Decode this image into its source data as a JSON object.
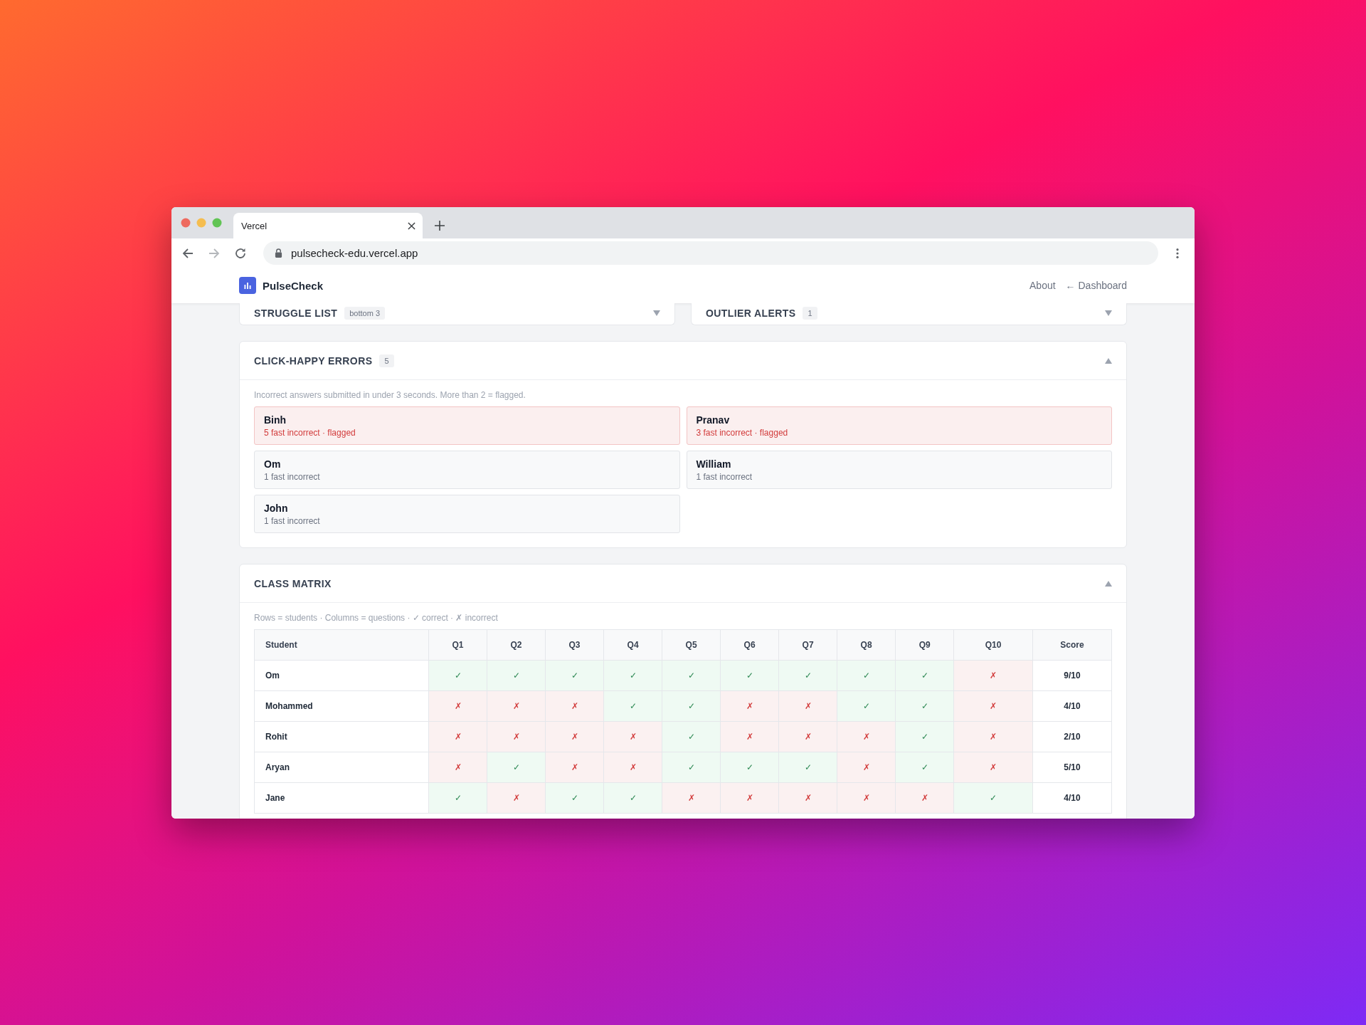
{
  "browser": {
    "tab_title": "Vercel",
    "url": "pulsecheck-edu.vercel.app"
  },
  "app": {
    "logo_text": "PulseCheck",
    "nav": [
      {
        "label": "About"
      },
      {
        "label": "← Dashboard"
      }
    ]
  },
  "top_panels": [
    {
      "title": "STRUGGLE LIST",
      "badge": "bottom 3",
      "expanded": false
    },
    {
      "title": "OUTLIER ALERTS",
      "badge": "1",
      "expanded": false
    }
  ],
  "click_happy": {
    "title": "CLICK-HAPPY ERRORS",
    "badge": "5",
    "expanded": true,
    "description": "Incorrect answers submitted in under 3 seconds. More than 2 = flagged.",
    "students": [
      {
        "name": "Binh",
        "detail": "5 fast incorrect · flagged",
        "flagged": true
      },
      {
        "name": "Pranav",
        "detail": "3 fast incorrect · flagged",
        "flagged": true
      },
      {
        "name": "Om",
        "detail": "1 fast incorrect",
        "flagged": false
      },
      {
        "name": "William",
        "detail": "1 fast incorrect",
        "flagged": false
      },
      {
        "name": "John",
        "detail": "1 fast incorrect",
        "flagged": false
      }
    ]
  },
  "class_matrix": {
    "title": "CLASS MATRIX",
    "expanded": true,
    "legend": "Rows = students · Columns = questions · ✓ correct · ✗ incorrect",
    "columns": [
      "Student",
      "Q1",
      "Q2",
      "Q3",
      "Q4",
      "Q5",
      "Q6",
      "Q7",
      "Q8",
      "Q9",
      "Q10",
      "Score"
    ],
    "rows": [
      {
        "cells": [
          {
            "kind": "student",
            "text": "Om"
          },
          {
            "kind": "answer",
            "text": "✓",
            "correct": true
          },
          {
            "kind": "answer",
            "text": "✓",
            "correct": true
          },
          {
            "kind": "answer",
            "text": "✓",
            "correct": true
          },
          {
            "kind": "answer",
            "text": "✓",
            "correct": true
          },
          {
            "kind": "answer",
            "text": "✓",
            "correct": true
          },
          {
            "kind": "answer",
            "text": "✓",
            "correct": true
          },
          {
            "kind": "answer",
            "text": "✓",
            "correct": true
          },
          {
            "kind": "answer",
            "text": "✓",
            "correct": true
          },
          {
            "kind": "answer",
            "text": "✓",
            "correct": true
          },
          {
            "kind": "answer",
            "text": "✗",
            "correct": false
          },
          {
            "kind": "score",
            "text": "9/10"
          }
        ]
      },
      {
        "cells": [
          {
            "kind": "student",
            "text": "Mohammed"
          },
          {
            "kind": "answer",
            "text": "✗",
            "correct": false
          },
          {
            "kind": "answer",
            "text": "✗",
            "correct": false
          },
          {
            "kind": "answer",
            "text": "✗",
            "correct": false
          },
          {
            "kind": "answer",
            "text": "✓",
            "correct": true
          },
          {
            "kind": "answer",
            "text": "✓",
            "correct": true
          },
          {
            "kind": "answer",
            "text": "✗",
            "correct": false
          },
          {
            "kind": "answer",
            "text": "✗",
            "correct": false
          },
          {
            "kind": "answer",
            "text": "✓",
            "correct": true
          },
          {
            "kind": "answer",
            "text": "✓",
            "correct": true
          },
          {
            "kind": "answer",
            "text": "✗",
            "correct": false
          },
          {
            "kind": "score",
            "text": "4/10"
          }
        ]
      },
      {
        "cells": [
          {
            "kind": "student",
            "text": "Rohit"
          },
          {
            "kind": "answer",
            "text": "✗",
            "correct": false
          },
          {
            "kind": "answer",
            "text": "✗",
            "correct": false
          },
          {
            "kind": "answer",
            "text": "✗",
            "correct": false
          },
          {
            "kind": "answer",
            "text": "✗",
            "correct": false
          },
          {
            "kind": "answer",
            "text": "✓",
            "correct": true
          },
          {
            "kind": "answer",
            "text": "✗",
            "correct": false
          },
          {
            "kind": "answer",
            "text": "✗",
            "correct": false
          },
          {
            "kind": "answer",
            "text": "✗",
            "correct": false
          },
          {
            "kind": "answer",
            "text": "✓",
            "correct": true
          },
          {
            "kind": "answer",
            "text": "✗",
            "correct": false
          },
          {
            "kind": "score",
            "text": "2/10"
          }
        ]
      },
      {
        "cells": [
          {
            "kind": "student",
            "text": "Aryan"
          },
          {
            "kind": "answer",
            "text": "✗",
            "correct": false
          },
          {
            "kind": "answer",
            "text": "✓",
            "correct": true
          },
          {
            "kind": "answer",
            "text": "✗",
            "correct": false
          },
          {
            "kind": "answer",
            "text": "✗",
            "correct": false
          },
          {
            "kind": "answer",
            "text": "✓",
            "correct": true
          },
          {
            "kind": "answer",
            "text": "✓",
            "correct": true
          },
          {
            "kind": "answer",
            "text": "✓",
            "correct": true
          },
          {
            "kind": "answer",
            "text": "✗",
            "correct": false
          },
          {
            "kind": "answer",
            "text": "✓",
            "correct": true
          },
          {
            "kind": "answer",
            "text": "✗",
            "correct": false
          },
          {
            "kind": "score",
            "text": "5/10"
          }
        ]
      },
      {
        "cells": [
          {
            "kind": "student",
            "text": "Jane"
          },
          {
            "kind": "answer",
            "text": "✓",
            "correct": true
          },
          {
            "kind": "answer",
            "text": "✗",
            "correct": false
          },
          {
            "kind": "answer",
            "text": "✓",
            "correct": true
          },
          {
            "kind": "answer",
            "text": "✓",
            "correct": true
          },
          {
            "kind": "answer",
            "text": "✗",
            "correct": false
          },
          {
            "kind": "answer",
            "text": "✗",
            "correct": false
          },
          {
            "kind": "answer",
            "text": "✗",
            "correct": false
          },
          {
            "kind": "answer",
            "text": "✗",
            "correct": false
          },
          {
            "kind": "answer",
            "text": "✗",
            "correct": false
          },
          {
            "kind": "answer",
            "text": "✓",
            "correct": true
          },
          {
            "kind": "score",
            "text": "4/10"
          }
        ]
      }
    ]
  }
}
